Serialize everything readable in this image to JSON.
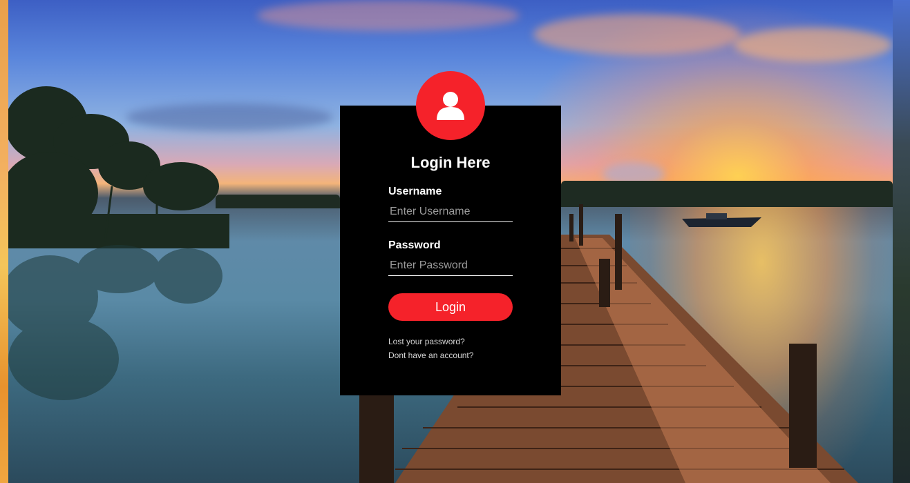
{
  "login": {
    "title": "Login Here",
    "username_label": "Username",
    "username_placeholder": "Enter Username",
    "username_value": "",
    "password_label": "Password",
    "password_placeholder": "Enter Password",
    "password_value": "",
    "submit_label": "Login",
    "lost_password_link": "Lost your password?",
    "no_account_link": "Dont have an account?",
    "avatar_icon": "user-icon"
  },
  "colors": {
    "accent": "#f5222a",
    "panel": "#000000",
    "text": "#ffffff"
  },
  "background": {
    "icon": "lake-dock-sunset-image"
  }
}
